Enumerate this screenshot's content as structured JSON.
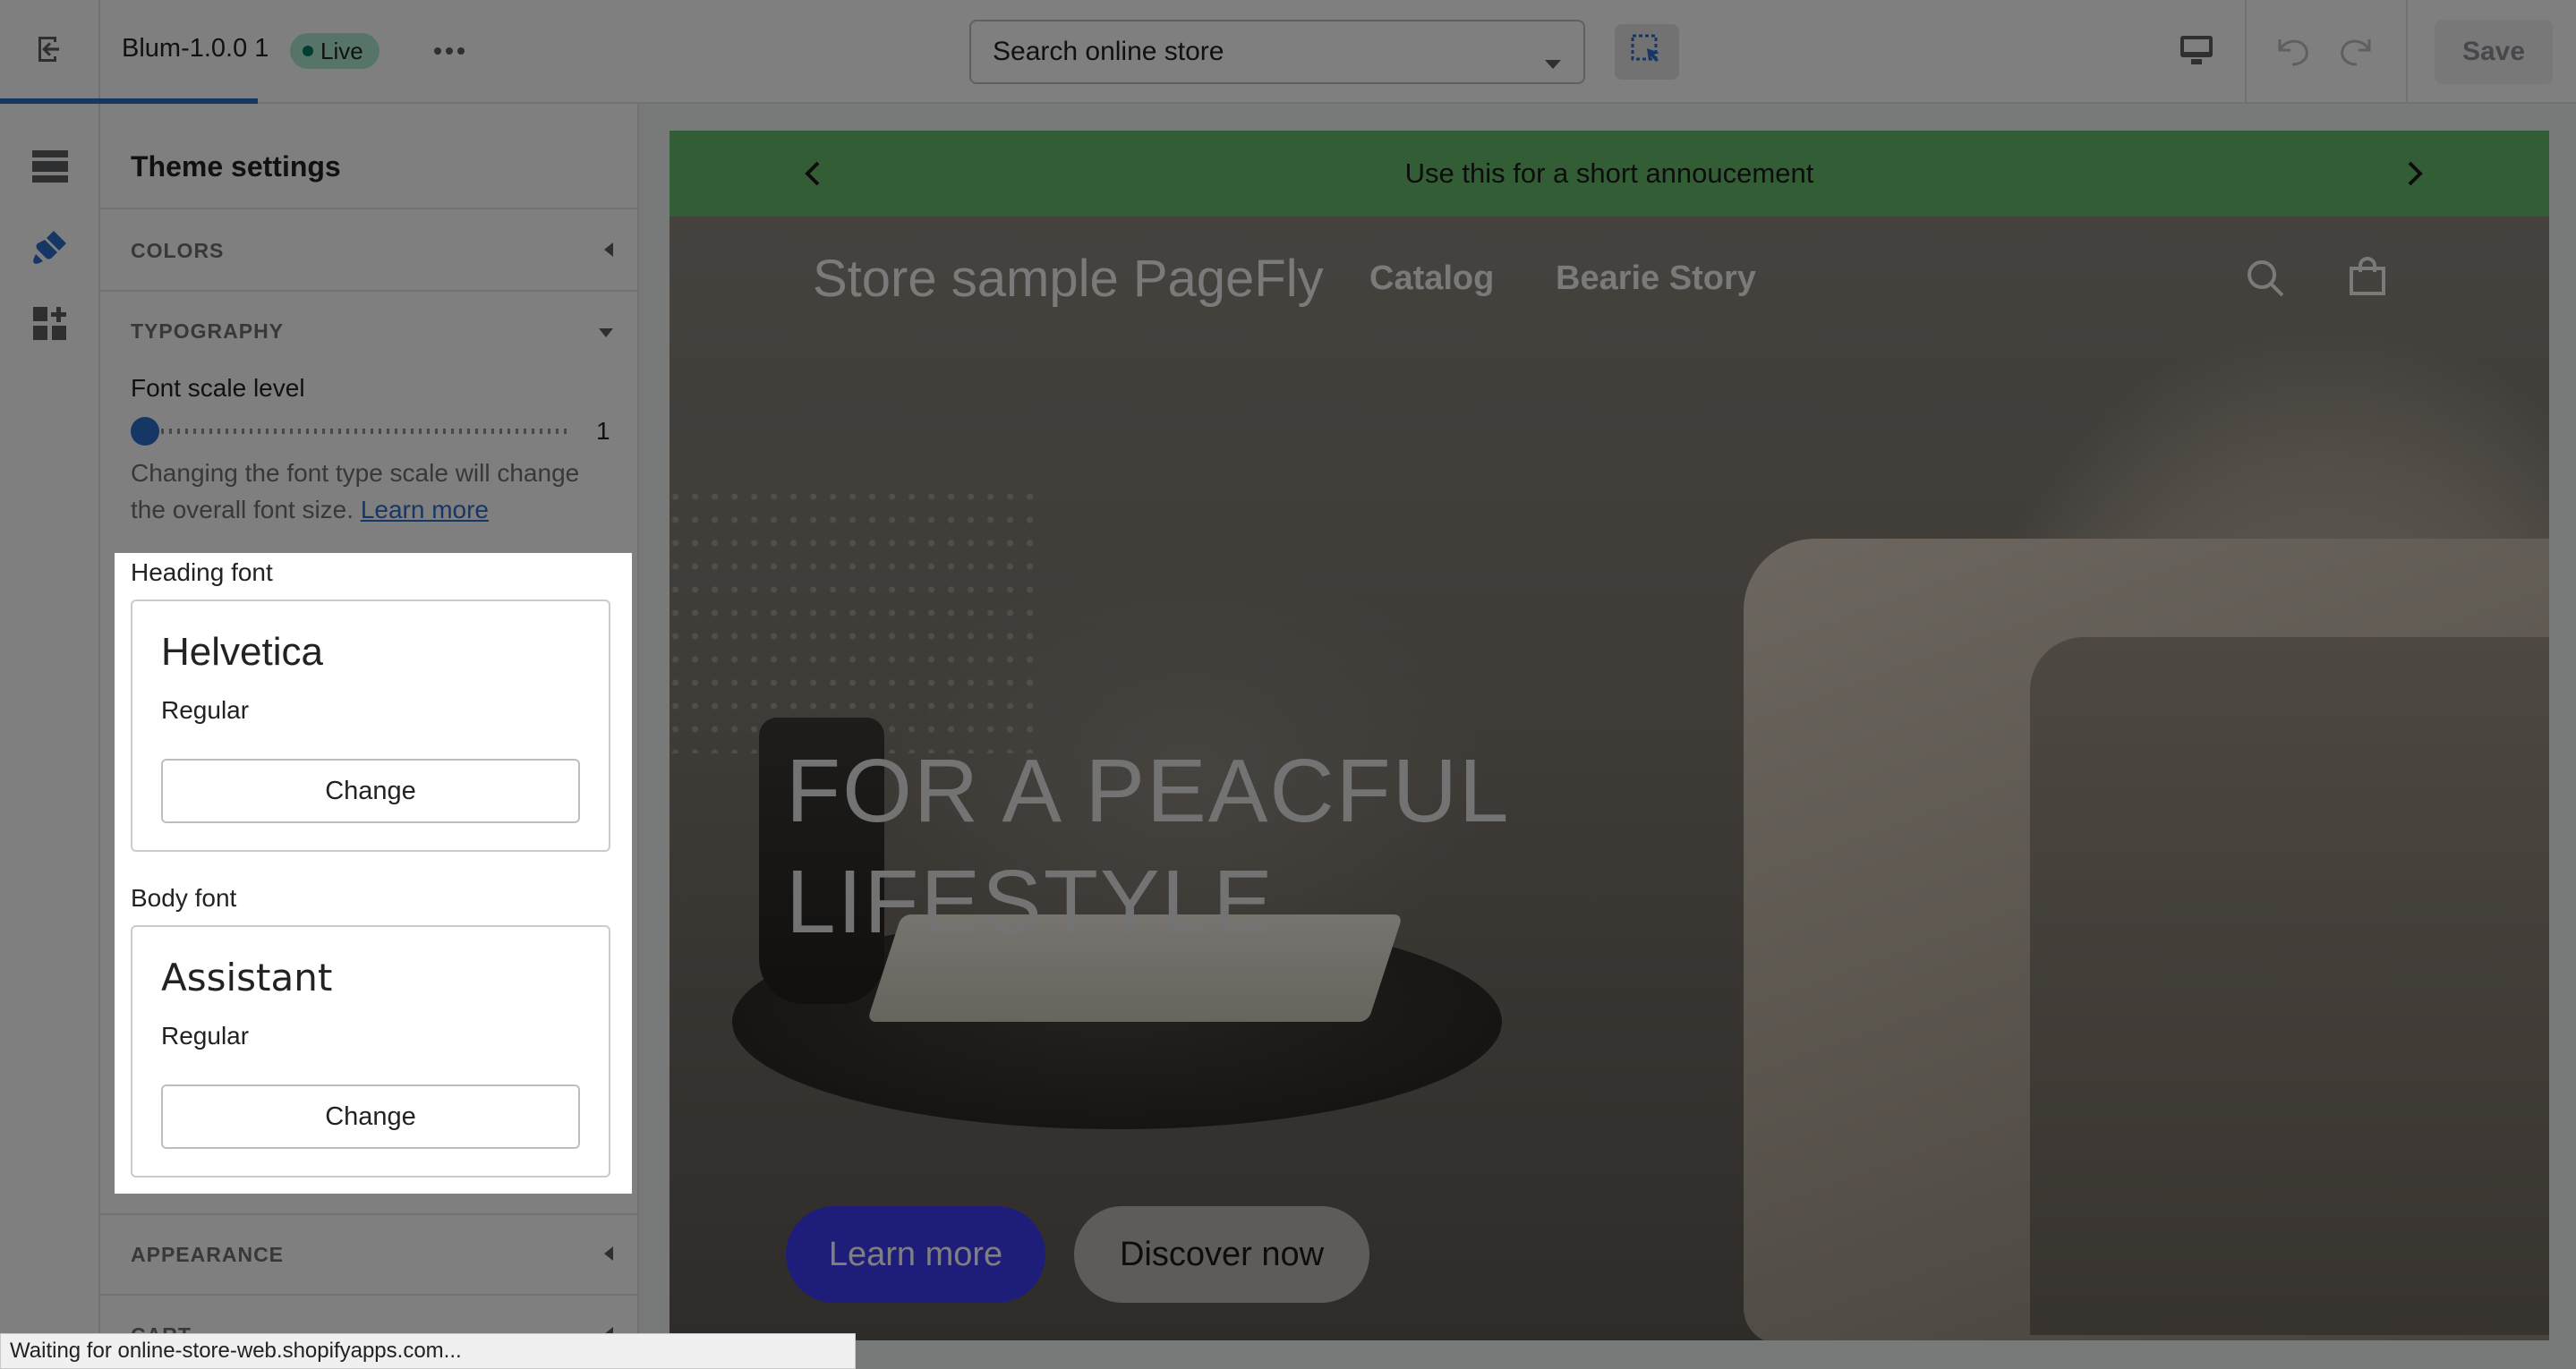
{
  "topbar": {
    "theme_name": "Blum-1.0.0 1",
    "status_badge": "Live",
    "search_select_value": "Search online store",
    "save_label": "Save",
    "icons": [
      "exit-icon",
      "more-horizontal-icon",
      "chevron-down-icon",
      "inspector-icon",
      "desktop-icon",
      "undo-icon",
      "redo-icon"
    ]
  },
  "rail": {
    "items": [
      "sections-icon",
      "theme-settings-icon",
      "apps-icon"
    ],
    "active_index": 1
  },
  "sidebar": {
    "title": "Theme settings",
    "sections": {
      "colors": "COLORS",
      "typography": "TYPOGRAPHY",
      "appearance": "APPEARANCE",
      "cart": "CART"
    },
    "typography": {
      "scale_label": "Font scale level",
      "scale_value": "1",
      "help_text": "Changing the font type scale will change the overall font size.",
      "help_link": "Learn more",
      "heading_font_label": "Heading font",
      "heading_font_name": "Helvetica",
      "heading_font_style": "Regular",
      "body_font_label": "Body font",
      "body_font_name": "Assistant",
      "body_font_style": "Regular",
      "change_label": "Change"
    }
  },
  "preview": {
    "announcement": "Use this for a short annoucement",
    "store_name": "Store sample PageFly",
    "nav": [
      "Catalog",
      "Bearie Story"
    ],
    "hero_title_line1": "FOR A PEACFUL",
    "hero_title_line2": "LIFESTYLE",
    "primary_button": "Learn more",
    "secondary_button": "Discover now",
    "colors": {
      "announcement_bg": "#66bb6a",
      "primary_button_bg": "#3d3df5"
    }
  },
  "status_bar": {
    "text": "Waiting for online-store-web.shopifyapps.com..."
  }
}
